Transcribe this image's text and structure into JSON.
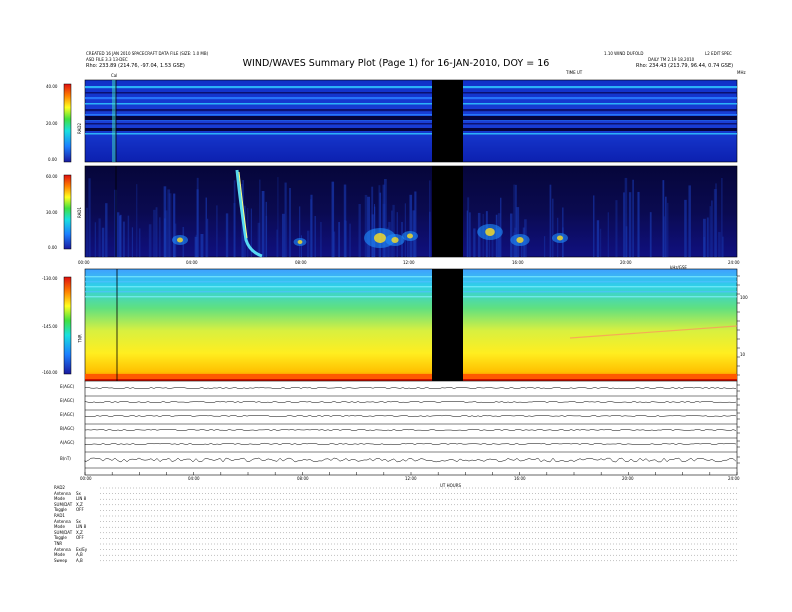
{
  "header": {
    "title": "WIND/WAVES Summary Plot (Page 1) for 16-JAN-2010, DOY = 16",
    "left_line1": "CREATED 16 JAN 2010 SPACECRAFT DATA FILE (SIZE: 1.0 MB)",
    "left_line2": "ASD FILE 3.3 13-DEC",
    "left_rho": "Rho:  233.89 (214.76, -97.04, 1.53 GSE)",
    "right_line1": "1.10 WIND DUFOLD",
    "right_line0": "L2 EDIT SPEC",
    "right_line2": "DAILY TM 2.19 18.2010",
    "right_rho": "Rho:  234.43 (213.79, 96.44, 0.74 GSE)",
    "cal_marker": "Cal",
    "mhz_right": "MHz",
    "title_subtag": "TIME UT"
  },
  "chart_data": [
    {
      "type": "heatmap",
      "name": "RAD2",
      "ylabel": "RAD2",
      "ylim": [
        0,
        40
      ],
      "y_ticks": [
        "40.00",
        "20.00",
        "0.00"
      ],
      "colorbar": "rainbow"
    },
    {
      "type": "heatmap",
      "name": "RAD1",
      "ylabel": "RAD1",
      "ylim": [
        0,
        60
      ],
      "y_ticks": [
        "60.00",
        "30.00",
        "0.00"
      ],
      "x_ticks": [
        "00:00",
        "04:00",
        "08:00",
        "12:00",
        "16:00",
        "20:00",
        "24:00"
      ],
      "xlabel_right": "kHz/GSE"
    },
    {
      "type": "heatmap",
      "name": "TNR",
      "ylabel": "TNR",
      "y_ticks": [
        "-130.00",
        "-145.00",
        "-160.00"
      ],
      "right_ticks": [
        "100",
        "10"
      ]
    },
    {
      "type": "line",
      "rows": [
        {
          "label": "E(AGC)"
        },
        {
          "label": "E(AGC)"
        },
        {
          "label": "E(AGC)"
        },
        {
          "label": "B(AGC)"
        },
        {
          "label": "A(AGC)"
        },
        {
          "label": "B(nT)"
        }
      ],
      "x_ticks": [
        "00:00",
        "04:00",
        "08:00",
        "12:00",
        "16:00",
        "20:00",
        "24:00"
      ],
      "xlabel": "UT HOURS"
    }
  ],
  "footer_rows": [
    {
      "label": "RAD2",
      "value": ""
    },
    {
      "label": "Antenna",
      "value": "Sx"
    },
    {
      "label": "Mode",
      "value": "LIN 8"
    },
    {
      "label": "SUM/DAT",
      "value": "X,Z"
    },
    {
      "label": "Toggle",
      "value": "OFF"
    },
    {
      "label": "RAD1",
      "value": ""
    },
    {
      "label": "Antenna",
      "value": "Sx"
    },
    {
      "label": "Mode",
      "value": "LIN 8"
    },
    {
      "label": "SUM/DAT",
      "value": "X,Z"
    },
    {
      "label": "Toggle",
      "value": "OFF"
    },
    {
      "label": "TNR",
      "value": ""
    },
    {
      "label": "Antenna",
      "value": "Ex/Ey"
    },
    {
      "label": "Mode",
      "value": "A,B"
    },
    {
      "label": "Sweep",
      "value": "A,B"
    }
  ]
}
